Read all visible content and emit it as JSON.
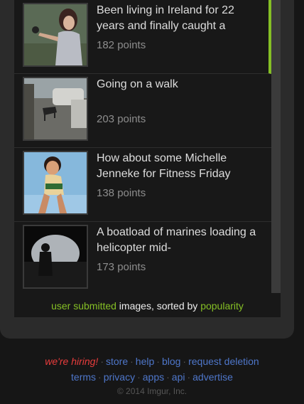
{
  "gallery": {
    "items": [
      {
        "title": "Been living in Ireland for 22 years and finally caught a",
        "points": "182 points"
      },
      {
        "title": "Going on a walk",
        "points": "203 points"
      },
      {
        "title": "How about some Michelle Jenneke for Fitness Friday",
        "points": "138 points"
      },
      {
        "title": "A boatload of marines loading a helicopter mid-",
        "points": "173 points"
      }
    ]
  },
  "caption": {
    "part1": "user submitted",
    "part2": " images, sorted by ",
    "part3": "popularity"
  },
  "footer": {
    "hiring": "we're hiring!",
    "links1": [
      "store",
      "help",
      "blog",
      "request deletion"
    ],
    "links2": [
      "terms",
      "privacy",
      "apps",
      "api",
      "advertise"
    ],
    "copyright": "© 2014 Imgur, Inc."
  },
  "colors": {
    "accent": "#85bf25",
    "link": "#4e76c9",
    "hiring": "#e83c3c"
  }
}
